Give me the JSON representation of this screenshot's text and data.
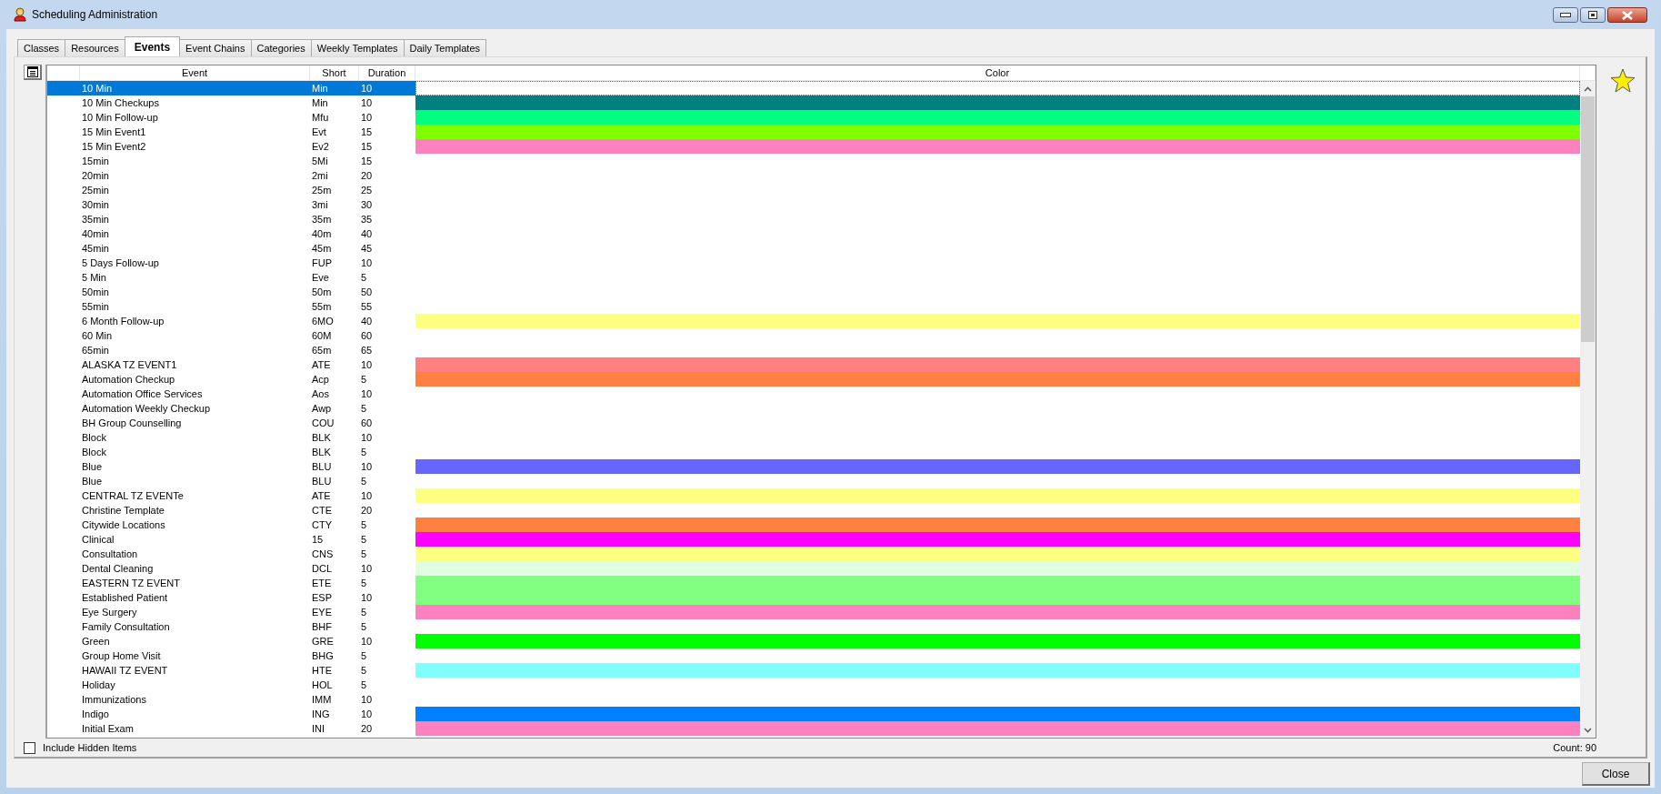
{
  "window": {
    "title": "Scheduling Administration"
  },
  "tabs": [
    {
      "label": "Classes",
      "selected": false
    },
    {
      "label": "Resources",
      "selected": false
    },
    {
      "label": "Events",
      "selected": true
    },
    {
      "label": "Event Chains",
      "selected": false
    },
    {
      "label": "Categories",
      "selected": false
    },
    {
      "label": "Weekly Templates",
      "selected": false
    },
    {
      "label": "Daily Templates",
      "selected": false
    }
  ],
  "grid": {
    "columns": [
      "Event",
      "Short",
      "Duration",
      "Color"
    ],
    "rows": [
      {
        "event": "10 Min",
        "short": "Min",
        "duration": "10",
        "selected": true
      },
      {
        "event": "10 Min Checkups",
        "short": "Min",
        "duration": "10",
        "selected": false,
        "color": "#008080"
      },
      {
        "event": "10 Min Follow-up",
        "short": "Mfu",
        "duration": "10",
        "selected": false,
        "color": "#00ff80"
      },
      {
        "event": "15 Min Event1",
        "short": "Evt",
        "duration": "15",
        "selected": false,
        "color": "#80ff00"
      },
      {
        "event": "15 Min Event2",
        "short": "Ev2",
        "duration": "15",
        "selected": false,
        "color": "#ff80c0"
      },
      {
        "event": "15min",
        "short": "5Mi",
        "duration": "15",
        "selected": false
      },
      {
        "event": "20min",
        "short": "2mi",
        "duration": "20",
        "selected": false
      },
      {
        "event": "25min",
        "short": "25m",
        "duration": "25",
        "selected": false
      },
      {
        "event": "30min",
        "short": "3mi",
        "duration": "30",
        "selected": false
      },
      {
        "event": "35min",
        "short": "35m",
        "duration": "35",
        "selected": false
      },
      {
        "event": "40min",
        "short": "40m",
        "duration": "40",
        "selected": false
      },
      {
        "event": "45min",
        "short": "45m",
        "duration": "45",
        "selected": false
      },
      {
        "event": "5 Days Follow-up",
        "short": "FUP",
        "duration": "10",
        "selected": false
      },
      {
        "event": "5 Min",
        "short": "Eve",
        "duration": "5",
        "selected": false
      },
      {
        "event": "50min",
        "short": "50m",
        "duration": "50",
        "selected": false
      },
      {
        "event": "55min",
        "short": "55m",
        "duration": "55",
        "selected": false
      },
      {
        "event": "6 Month Follow-up",
        "short": "6MO",
        "duration": "40",
        "selected": false,
        "color": "#ffff80"
      },
      {
        "event": "60 Min",
        "short": "60M",
        "duration": "60",
        "selected": false
      },
      {
        "event": "65min",
        "short": "65m",
        "duration": "65",
        "selected": false
      },
      {
        "event": "ALASKA TZ EVENT1",
        "short": "ATE",
        "duration": "10",
        "selected": false,
        "color": "#ff8080"
      },
      {
        "event": "Automation Checkup",
        "short": "Acp",
        "duration": "5",
        "selected": false,
        "color": "#ff8040"
      },
      {
        "event": "Automation Office Services",
        "short": "Aos",
        "duration": "10",
        "selected": false
      },
      {
        "event": "Automation Weekly Checkup",
        "short": "Awp",
        "duration": "5",
        "selected": false
      },
      {
        "event": "BH Group Counselling",
        "short": "COU",
        "duration": "60",
        "selected": false
      },
      {
        "event": "Block",
        "short": "BLK",
        "duration": "10",
        "selected": false
      },
      {
        "event": "Block",
        "short": "BLK",
        "duration": "5",
        "selected": false
      },
      {
        "event": "Blue",
        "short": "BLU",
        "duration": "10",
        "selected": false,
        "color": "#6666ff"
      },
      {
        "event": "Blue",
        "short": "BLU",
        "duration": "5",
        "selected": false
      },
      {
        "event": "CENTRAL TZ EVENTe",
        "short": "ATE",
        "duration": "10",
        "selected": false,
        "color": "#ffff80"
      },
      {
        "event": "Christine Template",
        "short": "CTE",
        "duration": "20",
        "selected": false
      },
      {
        "event": "Citywide Locations",
        "short": "CTY",
        "duration": "5",
        "selected": false,
        "color": "#ff8040"
      },
      {
        "event": "Clinical",
        "short": "15",
        "duration": "5",
        "selected": false,
        "color": "#ff00ff"
      },
      {
        "event": "Consultation",
        "short": "CNS",
        "duration": "5",
        "selected": false,
        "color": "#ffff80"
      },
      {
        "event": "Dental Cleaning",
        "short": "DCL",
        "duration": "10",
        "selected": false,
        "color": "#e0ffe0"
      },
      {
        "event": "EASTERN TZ EVENT",
        "short": "ETE",
        "duration": "5",
        "selected": false,
        "color": "#80ff80"
      },
      {
        "event": "Established Patient",
        "short": "ESP",
        "duration": "10",
        "selected": false,
        "color": "#80ff80"
      },
      {
        "event": "Eye Surgery",
        "short": "EYE",
        "duration": "5",
        "selected": false,
        "color": "#ff80c0"
      },
      {
        "event": "Family Consultation",
        "short": "BHF",
        "duration": "5",
        "selected": false
      },
      {
        "event": "Green",
        "short": "GRE",
        "duration": "10",
        "selected": false,
        "color": "#00ff00"
      },
      {
        "event": "Group Home Visit",
        "short": "BHG",
        "duration": "5",
        "selected": false
      },
      {
        "event": "HAWAII TZ EVENT",
        "short": "HTE",
        "duration": "5",
        "selected": false,
        "color": "#80ffff"
      },
      {
        "event": "Holiday",
        "short": "HOL",
        "duration": "5",
        "selected": false
      },
      {
        "event": "Immunizations",
        "short": "IMM",
        "duration": "10",
        "selected": false
      },
      {
        "event": "Indigo",
        "short": "ING",
        "duration": "10",
        "selected": false,
        "color": "#0080ff"
      },
      {
        "event": "Initial Exam",
        "short": "INI",
        "duration": "20",
        "selected": false,
        "color": "#ff80c0"
      }
    ]
  },
  "include_hidden": {
    "label": "Include Hidden Items",
    "checked": false
  },
  "count": "Count: 90",
  "buttons": [
    "Close"
  ]
}
